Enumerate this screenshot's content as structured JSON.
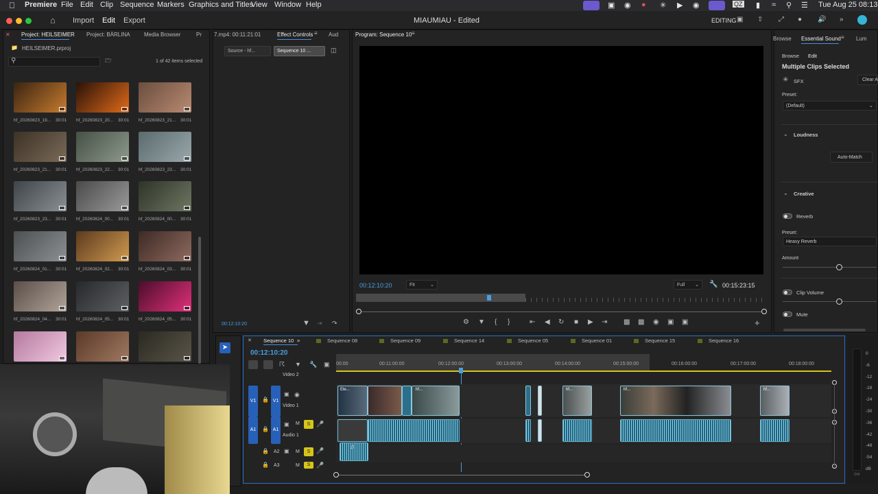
{
  "menubar": {
    "app": "Premiere",
    "items": [
      "File",
      "Edit",
      "Clip",
      "Sequence",
      "Markers",
      "Graphics and Titles",
      "View",
      "Window",
      "Help"
    ],
    "clock": "Tue Aug 25  08:13"
  },
  "titlebar": {
    "title": "MIAUMIAU - Edited",
    "workspaces": [
      "Import",
      "Edit",
      "Export"
    ],
    "mode": "EDITING"
  },
  "project": {
    "tab_active": "Project: HEILSEIMER",
    "tab2": "Project: BÄRLINA",
    "tab3": "Media Browser",
    "tab4": "Pr",
    "file": "HEILSEIMER.prproj",
    "selection": "1 of 42 items selected",
    "items": [
      {
        "name": "hf_20260823_19...",
        "dur": "30:01",
        "c1": "#3a2412",
        "c2": "#c77b2e"
      },
      {
        "name": "hf_20260823_20...",
        "dur": "30:01",
        "c1": "#2a1208",
        "c2": "#e06a1a"
      },
      {
        "name": "hf_20260823_21...",
        "dur": "30:01",
        "c1": "#6b4e3e",
        "c2": "#b88a72"
      },
      {
        "name": "hf_20260823_21...",
        "dur": "30:01",
        "c1": "#3c3226",
        "c2": "#7a6a58"
      },
      {
        "name": "hf_20260823_22...",
        "dur": "30:01",
        "c1": "#465046",
        "c2": "#8e9a8e"
      },
      {
        "name": "hf_20260823_23...",
        "dur": "30:01",
        "c1": "#5a6a6e",
        "c2": "#9aa8aa"
      },
      {
        "name": "hf_20260823_23...",
        "dur": "30:01",
        "c1": "#3e4448",
        "c2": "#8a9094"
      },
      {
        "name": "hf_20260824_00...",
        "dur": "30:01",
        "c1": "#4a4a4a",
        "c2": "#9a9a9a"
      },
      {
        "name": "hf_20260824_00...",
        "dur": "30:01",
        "c1": "#2e3428",
        "c2": "#6e7662"
      },
      {
        "name": "hf_20260824_01...",
        "dur": "30:01",
        "c1": "#4c5052",
        "c2": "#8c9092"
      },
      {
        "name": "hf_20260824_02...",
        "dur": "30:01",
        "c1": "#5c3a1e",
        "c2": "#d09a50"
      },
      {
        "name": "hf_20260824_03...",
        "dur": "30:01",
        "c1": "#3e2a26",
        "c2": "#8e6a5e"
      },
      {
        "name": "hf_20260824_04...",
        "dur": "30:01",
        "c1": "#5a4e48",
        "c2": "#b0a49a"
      },
      {
        "name": "hf_20260824_05...",
        "dur": "30:01",
        "c1": "#26282a",
        "c2": "#5e6064"
      },
      {
        "name": "hf_20260824_05...",
        "dur": "30:01",
        "c1": "#4a0e2a",
        "c2": "#e0307a"
      },
      {
        "name": "",
        "dur": "",
        "c1": "#b47a9e",
        "c2": "#f0c8e0"
      },
      {
        "name": "",
        "dur": "",
        "c1": "#5a3a2a",
        "c2": "#a07860"
      },
      {
        "name": "",
        "dur": "",
        "c1": "#2a2a22",
        "c2": "#5a5448"
      }
    ]
  },
  "effect_panel": {
    "source_tab": "7.mp4: 00:11:21:01",
    "active_tab": "Effect Controls",
    "tab3": "Aud",
    "source_btn": "Source - hf...",
    "seq_btn": "Sequence 10 ...",
    "timecode": "00:12:10:20"
  },
  "program": {
    "title": "Program: Sequence 10",
    "timecode": "00:12:10:20",
    "fit": "Fit",
    "quality": "Full",
    "duration": "00:15:23:15"
  },
  "sound": {
    "tab1": "Browse",
    "tab_active": "Essential Sound",
    "tab3": "Lum",
    "sub_browse": "Browse",
    "sub_edit": "Edit",
    "heading": "Multiple Clips Selected",
    "type": "SFX",
    "clear": "Clear A",
    "preset_label": "Preset:",
    "preset_value": "(Default)",
    "loudness": "Loudness",
    "auto_match": "Auto-Match",
    "creative": "Creative",
    "reverb": "Reverb",
    "reverb_preset_label": "Preset:",
    "reverb_preset": "Heavy Reverb",
    "amount": "Amount",
    "amount_level": 0.6,
    "clip_volume": "Clip Volume",
    "clip_volume_level": 0.6,
    "mute": "Mute"
  },
  "timeline": {
    "timecode": "00:12:10:20",
    "sequences": [
      "Sequence 10",
      "Sequence 08",
      "Sequence 09",
      "Sequence 14",
      "Sequence 05",
      "Sequence 01",
      "Sequence 15",
      "Sequence 16"
    ],
    "ruler": [
      "00:00",
      "00:11:00:00",
      "00:12:00:00",
      "00:13:00:00",
      "00:14:00:00",
      "00:15:00:00",
      "00:16:00:00",
      "00:17:00:00",
      "00:18:00:00"
    ],
    "tracks": {
      "v2": "Video 2",
      "v1": "Video 1",
      "a1": "Audio 1",
      "v1_btn": "V1",
      "v1_target": "V1",
      "a1_btn": "A1",
      "a1_target": "A1",
      "a2": "A2",
      "a3": "A3",
      "m": "M",
      "s": "S"
    },
    "clip_labels": [
      "Ele...",
      "hf...",
      "hf...",
      "hf...",
      "hf..."
    ]
  },
  "meter": {
    "labels": [
      "0",
      "-6",
      "-12",
      "-18",
      "-24",
      "-30",
      "-36",
      "-42",
      "-48",
      "-54",
      "dB"
    ]
  }
}
